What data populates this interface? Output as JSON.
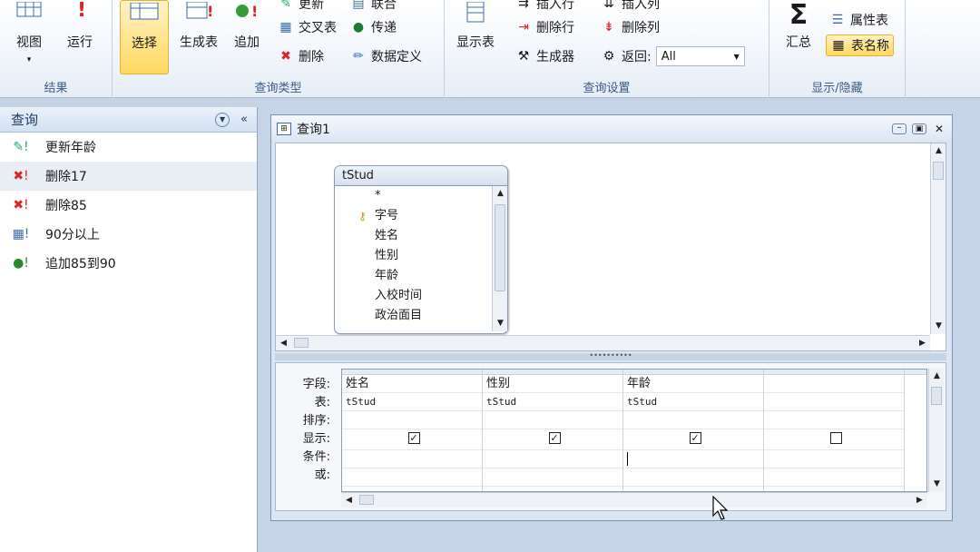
{
  "ribbon": {
    "groups": {
      "results": "结果",
      "query_type": "查询类型",
      "query_setup": "查询设置",
      "show_hide": "显示/隐藏"
    },
    "buttons": {
      "view": "视图",
      "run": "运行",
      "select": "选择",
      "make_table": "生成表",
      "append": "追加",
      "show_table": "显示表",
      "totals": "汇总"
    },
    "small": {
      "update": "更新",
      "crosstab": "交叉表",
      "delete": "删除",
      "union": "联合",
      "pass_through": "传递",
      "data_definition": "数据定义",
      "insert_rows": "插入行",
      "delete_rows": "删除行",
      "builder": "生成器",
      "insert_cols": "插入列",
      "delete_cols": "删除列",
      "return": "返回:",
      "return_value": "All",
      "property_sheet": "属性表",
      "table_names": "表名称"
    }
  },
  "nav": {
    "title": "查询",
    "items": [
      {
        "label": "更新年龄",
        "icon": "update-query-icon"
      },
      {
        "label": "删除17",
        "icon": "delete-query-icon"
      },
      {
        "label": "删除85",
        "icon": "delete-query-icon"
      },
      {
        "label": "90分以上",
        "icon": "make-table-query-icon"
      },
      {
        "label": "追加85到90",
        "icon": "append-query-icon"
      }
    ]
  },
  "query": {
    "title": "查询1",
    "table": {
      "name": "tStud",
      "fields": [
        "*",
        "字号",
        "姓名",
        "性别",
        "年龄",
        "入校时间",
        "政治面目"
      ]
    },
    "row_labels": [
      "字段:",
      "表:",
      "排序:",
      "显示:",
      "条件:",
      "或:"
    ],
    "columns": [
      {
        "field": "姓名",
        "table": "tStud",
        "show": true
      },
      {
        "field": "性别",
        "table": "tStud",
        "show": true
      },
      {
        "field": "年龄",
        "table": "tStud",
        "show": true
      },
      {
        "field": "",
        "table": "",
        "show": false
      }
    ]
  }
}
